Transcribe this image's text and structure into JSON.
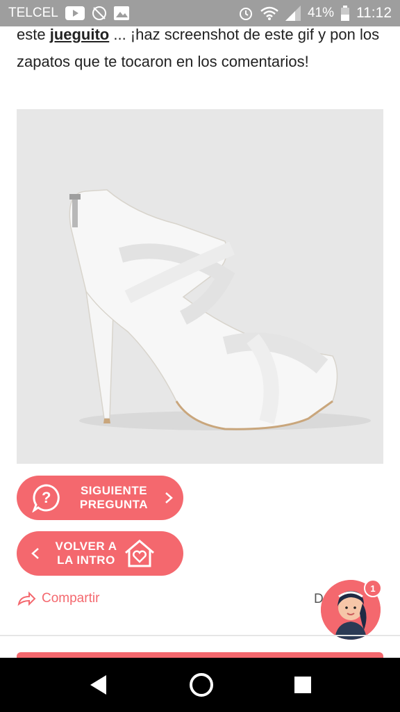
{
  "status_bar": {
    "carrier": "TELCEL",
    "battery": "41%",
    "time": "11:12"
  },
  "article": {
    "text_before": "este ",
    "link": "jueguito",
    "text_after": " ... ¡haz screenshot de este gif y pon los zapatos que te tocaron en los comentarios!"
  },
  "buttons": {
    "next_label": "SIGUIENTE PREGUNTA",
    "back_label": "VOLVER A LA INTRO"
  },
  "share": {
    "label": "Compartir"
  },
  "trailing_text": "D",
  "assistant": {
    "badge_count": "1"
  },
  "colors": {
    "accent": "#f4686e",
    "status_bar": "#9e9e9e",
    "image_background": "#e7e7e7"
  }
}
